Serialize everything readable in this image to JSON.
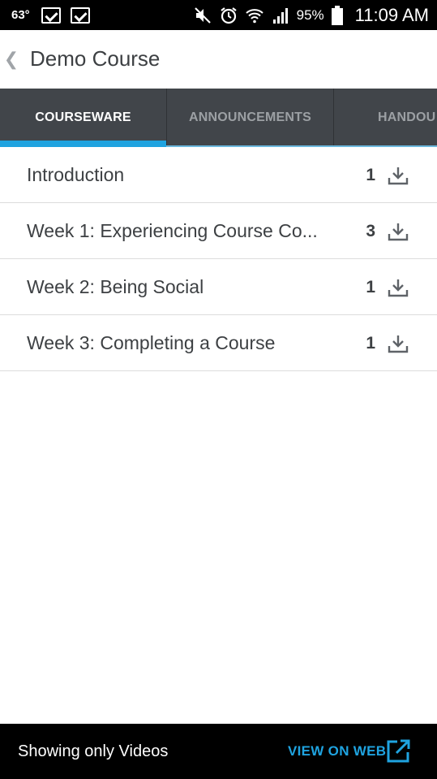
{
  "status_bar": {
    "temperature": "63°",
    "battery_percent": "95%",
    "time": "11:09 AM",
    "icons": [
      "checkbox-notification-icon",
      "checkbox-notification-icon",
      "mute-icon",
      "alarm-icon",
      "wifi-icon",
      "signal-icon",
      "battery-icon"
    ]
  },
  "header": {
    "back_glyph": "❮",
    "title": "Demo Course"
  },
  "tabs": [
    {
      "label": "COURSEWARE",
      "selected": true
    },
    {
      "label": "ANNOUNCEMENTS",
      "selected": false
    },
    {
      "label": "HANDOU",
      "selected": false
    }
  ],
  "sections": [
    {
      "title": "Introduction",
      "count": "1"
    },
    {
      "title": "Week 1: Experiencing Course Co...",
      "count": "3"
    },
    {
      "title": "Week 2: Being Social",
      "count": "1"
    },
    {
      "title": "Week 3: Completing a Course",
      "count": "1"
    }
  ],
  "bottom_bar": {
    "filter_text": "Showing only Videos",
    "view_on_web": "VIEW ON WEB"
  },
  "colors": {
    "accent": "#1fa3e0",
    "tab_bar": "#41454a",
    "text_dark": "#3d4043"
  }
}
